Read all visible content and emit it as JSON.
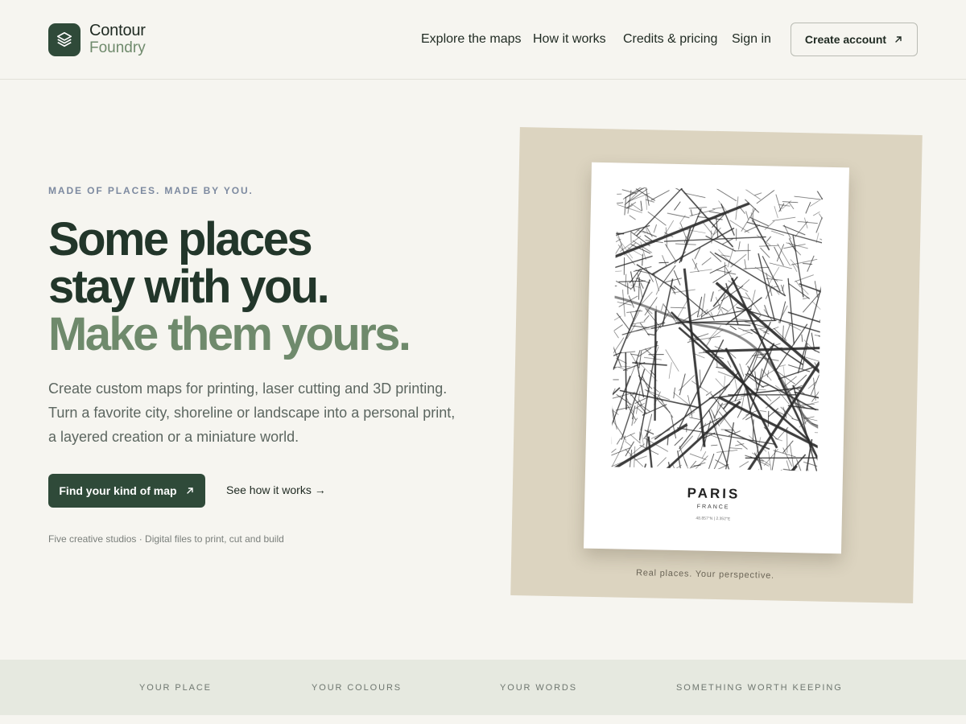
{
  "brand": {
    "name": "Contour",
    "sub": "Foundry",
    "icon": "layers-icon",
    "color": "#2f4a39"
  },
  "nav": {
    "items": [
      {
        "label": "Explore the maps"
      },
      {
        "label": "How it works"
      },
      {
        "label": "Credits & pricing"
      },
      {
        "label": "Sign in"
      }
    ],
    "cta_label": "Create account",
    "cta_icon": "arrow-up-right-icon"
  },
  "hero": {
    "eyebrow": "MADE OF PLACES. MADE BY YOU.",
    "headline_line1": "Some places",
    "headline_line2": "stay with you.",
    "headline_line3": "Make them yours.",
    "lede": "Create custom maps for printing, laser cutting and 3D printing. Turn a favorite city, shoreline or landscape into a personal print, a layered creation or a miniature world.",
    "primary_label": "Find your kind of map",
    "secondary_label": "See how it works →",
    "footnote": "Five creative studios · Digital files to print, cut and build"
  },
  "poster": {
    "city": "PARIS",
    "country": "FRANCE",
    "coords": "48.857°N | 2.352°E",
    "caption": "Real places. Your perspective."
  },
  "strip": {
    "items": [
      "YOUR PLACE",
      "YOUR COLOURS",
      "YOUR WORDS",
      "SOMETHING WORTH KEEPING"
    ]
  },
  "colors": {
    "background": "#f6f5f0",
    "accent_dark": "#2f4a39",
    "accent_sage": "#6f8a6c",
    "art_backdrop": "#dcd4c0",
    "strip": "#e6e9e0"
  }
}
